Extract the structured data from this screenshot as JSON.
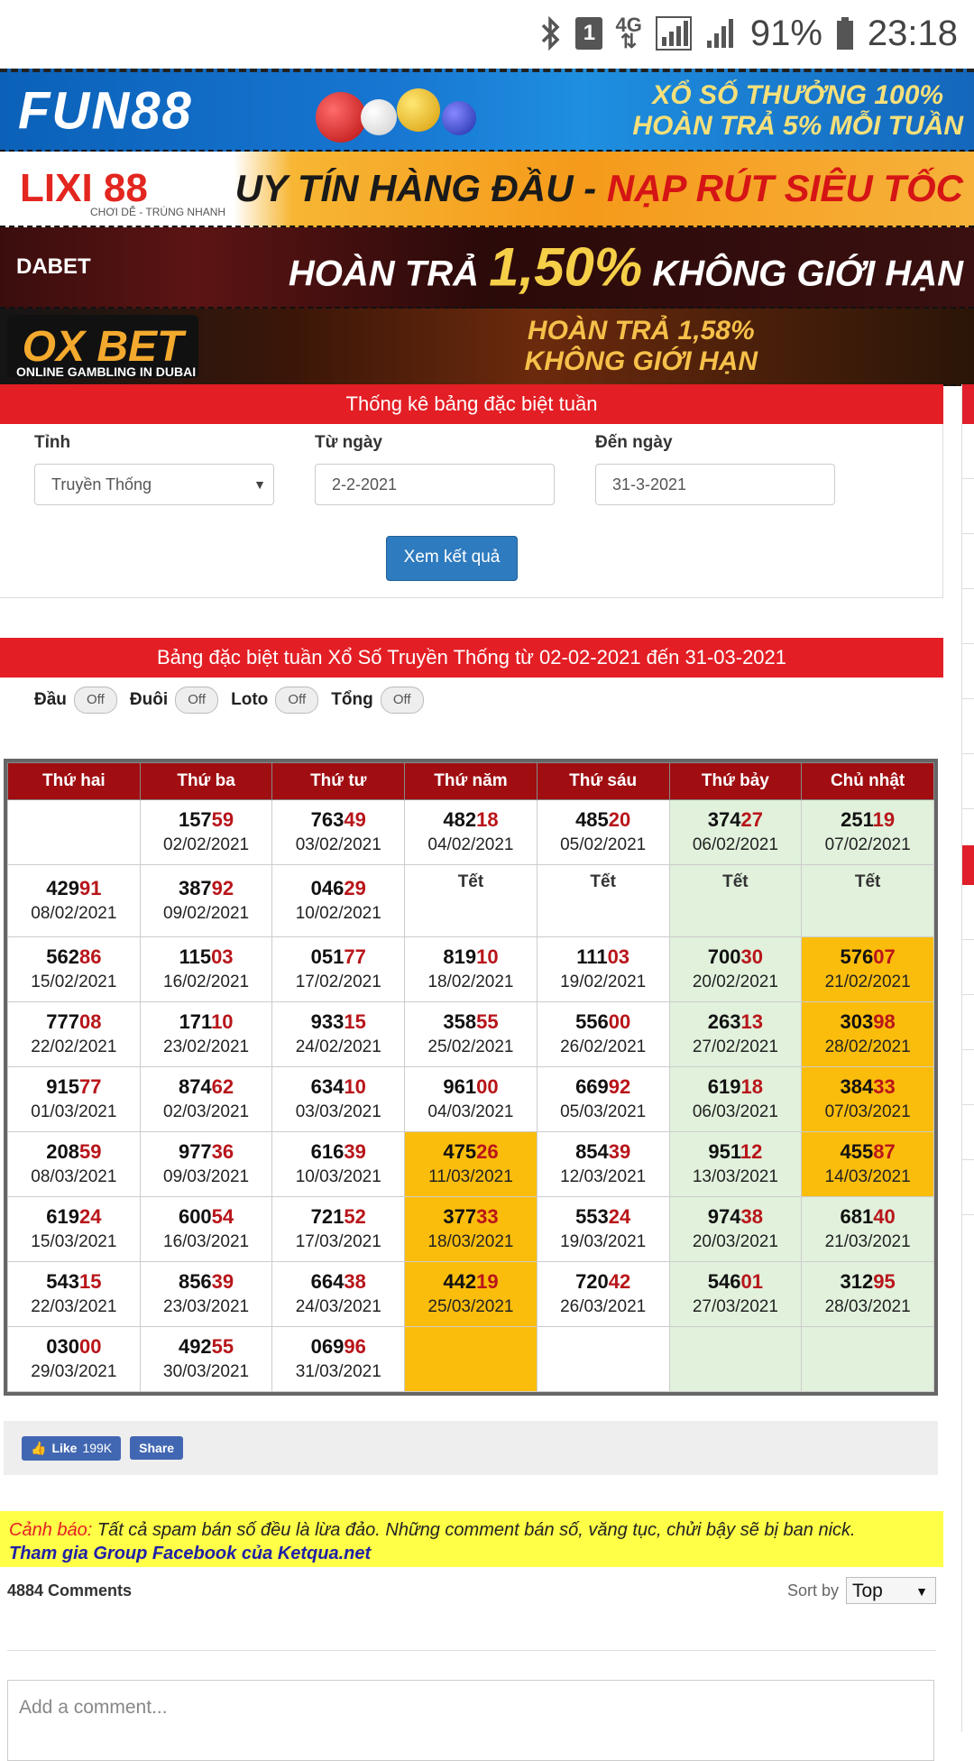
{
  "status": {
    "battery": "91%",
    "time": "23:18",
    "sim": "1",
    "net": "4G"
  },
  "banners": {
    "fun88": {
      "brand": "FUN88",
      "line1": "XỔ SỐ THƯỞNG 100%",
      "line2": "HOÀN TRẢ 5% MỖI TUẦN"
    },
    "lixi88": {
      "brand": "LIXI 88",
      "sub": "CHƠI DỄ - TRÚNG NHANH",
      "text1": "UY TÍN HÀNG ĐẦU - ",
      "text2": "NẠP RÚT SIÊU TỐC"
    },
    "dabet": {
      "brand": "DABET",
      "text1": "HOÀN TRẢ ",
      "text2": "1,50%",
      "text3": " KHÔNG GIỚI HẠN"
    },
    "oxbet": {
      "brand": "OX BET",
      "sub": "ONLINE GAMBLING IN DUBAI",
      "line1": "HOÀN TRẢ 1,58%",
      "line2": "KHÔNG GIỚI HẠN"
    }
  },
  "form": {
    "title": "Thống kê bảng đặc biệt tuần",
    "province_label": "Tỉnh",
    "province_value": "Truyền Thống",
    "from_label": "Từ ngày",
    "from_value": "2-2-2021",
    "to_label": "Đến ngày",
    "to_value": "31-3-2021",
    "submit": "Xem kết quả"
  },
  "results": {
    "title": "Bảng đặc biệt tuần Xổ Số Truyền Thống từ 02-02-2021 đến 31-03-2021",
    "toggles": [
      {
        "label": "Đầu",
        "state": "Off"
      },
      {
        "label": "Đuôi",
        "state": "Off"
      },
      {
        "label": "Loto",
        "state": "Off"
      },
      {
        "label": "Tổng",
        "state": "Off"
      }
    ],
    "headers": [
      "Thứ hai",
      "Thứ ba",
      "Thứ tư",
      "Thứ năm",
      "Thứ sáu",
      "Thứ bảy",
      "Chủ nhật"
    ],
    "rows": [
      [
        null,
        {
          "h": "157",
          "t": "59",
          "d": "02/02/2021"
        },
        {
          "h": "763",
          "t": "49",
          "d": "03/02/2021"
        },
        {
          "h": "482",
          "t": "18",
          "d": "04/02/2021"
        },
        {
          "h": "485",
          "t": "20",
          "d": "05/02/2021"
        },
        {
          "h": "374",
          "t": "27",
          "d": "06/02/2021"
        },
        {
          "h": "251",
          "t": "19",
          "d": "07/02/2021"
        }
      ],
      [
        {
          "h": "429",
          "t": "91",
          "d": "08/02/2021"
        },
        {
          "h": "387",
          "t": "92",
          "d": "09/02/2021"
        },
        {
          "h": "046",
          "t": "29",
          "d": "10/02/2021"
        },
        {
          "tet": "Tết"
        },
        {
          "tet": "Tết"
        },
        {
          "tet": "Tết"
        },
        {
          "tet": "Tết"
        }
      ],
      [
        {
          "h": "562",
          "t": "86",
          "d": "15/02/2021"
        },
        {
          "h": "115",
          "t": "03",
          "d": "16/02/2021"
        },
        {
          "h": "051",
          "t": "77",
          "d": "17/02/2021"
        },
        {
          "h": "819",
          "t": "10",
          "d": "18/02/2021"
        },
        {
          "h": "111",
          "t": "03",
          "d": "19/02/2021"
        },
        {
          "h": "700",
          "t": "30",
          "d": "20/02/2021"
        },
        {
          "h": "576",
          "t": "07",
          "d": "21/02/2021",
          "hl": true
        }
      ],
      [
        {
          "h": "777",
          "t": "08",
          "d": "22/02/2021"
        },
        {
          "h": "171",
          "t": "10",
          "d": "23/02/2021"
        },
        {
          "h": "933",
          "t": "15",
          "d": "24/02/2021"
        },
        {
          "h": "358",
          "t": "55",
          "d": "25/02/2021"
        },
        {
          "h": "556",
          "t": "00",
          "d": "26/02/2021"
        },
        {
          "h": "263",
          "t": "13",
          "d": "27/02/2021"
        },
        {
          "h": "303",
          "t": "98",
          "d": "28/02/2021",
          "hl": true
        }
      ],
      [
        {
          "h": "915",
          "t": "77",
          "d": "01/03/2021"
        },
        {
          "h": "874",
          "t": "62",
          "d": "02/03/2021"
        },
        {
          "h": "634",
          "t": "10",
          "d": "03/03/2021"
        },
        {
          "h": "961",
          "t": "00",
          "d": "04/03/2021"
        },
        {
          "h": "669",
          "t": "92",
          "d": "05/03/2021"
        },
        {
          "h": "619",
          "t": "18",
          "d": "06/03/2021"
        },
        {
          "h": "384",
          "t": "33",
          "d": "07/03/2021",
          "hl": true
        }
      ],
      [
        {
          "h": "208",
          "t": "59",
          "d": "08/03/2021"
        },
        {
          "h": "977",
          "t": "36",
          "d": "09/03/2021"
        },
        {
          "h": "616",
          "t": "39",
          "d": "10/03/2021"
        },
        {
          "h": "475",
          "t": "26",
          "d": "11/03/2021",
          "hl": true
        },
        {
          "h": "854",
          "t": "39",
          "d": "12/03/2021"
        },
        {
          "h": "951",
          "t": "12",
          "d": "13/03/2021"
        },
        {
          "h": "455",
          "t": "87",
          "d": "14/03/2021",
          "hl": true
        }
      ],
      [
        {
          "h": "619",
          "t": "24",
          "d": "15/03/2021"
        },
        {
          "h": "600",
          "t": "54",
          "d": "16/03/2021"
        },
        {
          "h": "721",
          "t": "52",
          "d": "17/03/2021"
        },
        {
          "h": "377",
          "t": "33",
          "d": "18/03/2021",
          "hl": true
        },
        {
          "h": "553",
          "t": "24",
          "d": "19/03/2021"
        },
        {
          "h": "974",
          "t": "38",
          "d": "20/03/2021"
        },
        {
          "h": "681",
          "t": "40",
          "d": "21/03/2021"
        }
      ],
      [
        {
          "h": "543",
          "t": "15",
          "d": "22/03/2021"
        },
        {
          "h": "856",
          "t": "39",
          "d": "23/03/2021"
        },
        {
          "h": "664",
          "t": "38",
          "d": "24/03/2021"
        },
        {
          "h": "442",
          "t": "19",
          "d": "25/03/2021",
          "hl": true
        },
        {
          "h": "720",
          "t": "42",
          "d": "26/03/2021"
        },
        {
          "h": "546",
          "t": "01",
          "d": "27/03/2021"
        },
        {
          "h": "312",
          "t": "95",
          "d": "28/03/2021"
        }
      ],
      [
        {
          "h": "030",
          "t": "00",
          "d": "29/03/2021"
        },
        {
          "h": "492",
          "t": "55",
          "d": "30/03/2021"
        },
        {
          "h": "069",
          "t": "96",
          "d": "31/03/2021"
        },
        {
          "empty": true,
          "hl": true
        },
        null,
        null,
        null
      ]
    ]
  },
  "social": {
    "like": "Like",
    "like_count": "199K",
    "share": "Share"
  },
  "warning": {
    "label": "Cảnh báo:",
    "text": " Tất cả spam bán số đều là lừa đảo. Những comment bán số, văng tục, chửi bậy sẽ bị ban nick.",
    "link": "Tham gia Group Facebook của Ketqua.net"
  },
  "comments": {
    "count": "4884 Comments",
    "sort_label": "Sort by",
    "sort_value": "Top",
    "placeholder": "Add a comment..."
  },
  "colors": {
    "header_red": "#e31e24",
    "table_head": "#a00e12",
    "weekend": "#e1f1dc",
    "highlight": "#fbbd0c",
    "tail": "#b8151a",
    "button": "#2e7bbf"
  }
}
